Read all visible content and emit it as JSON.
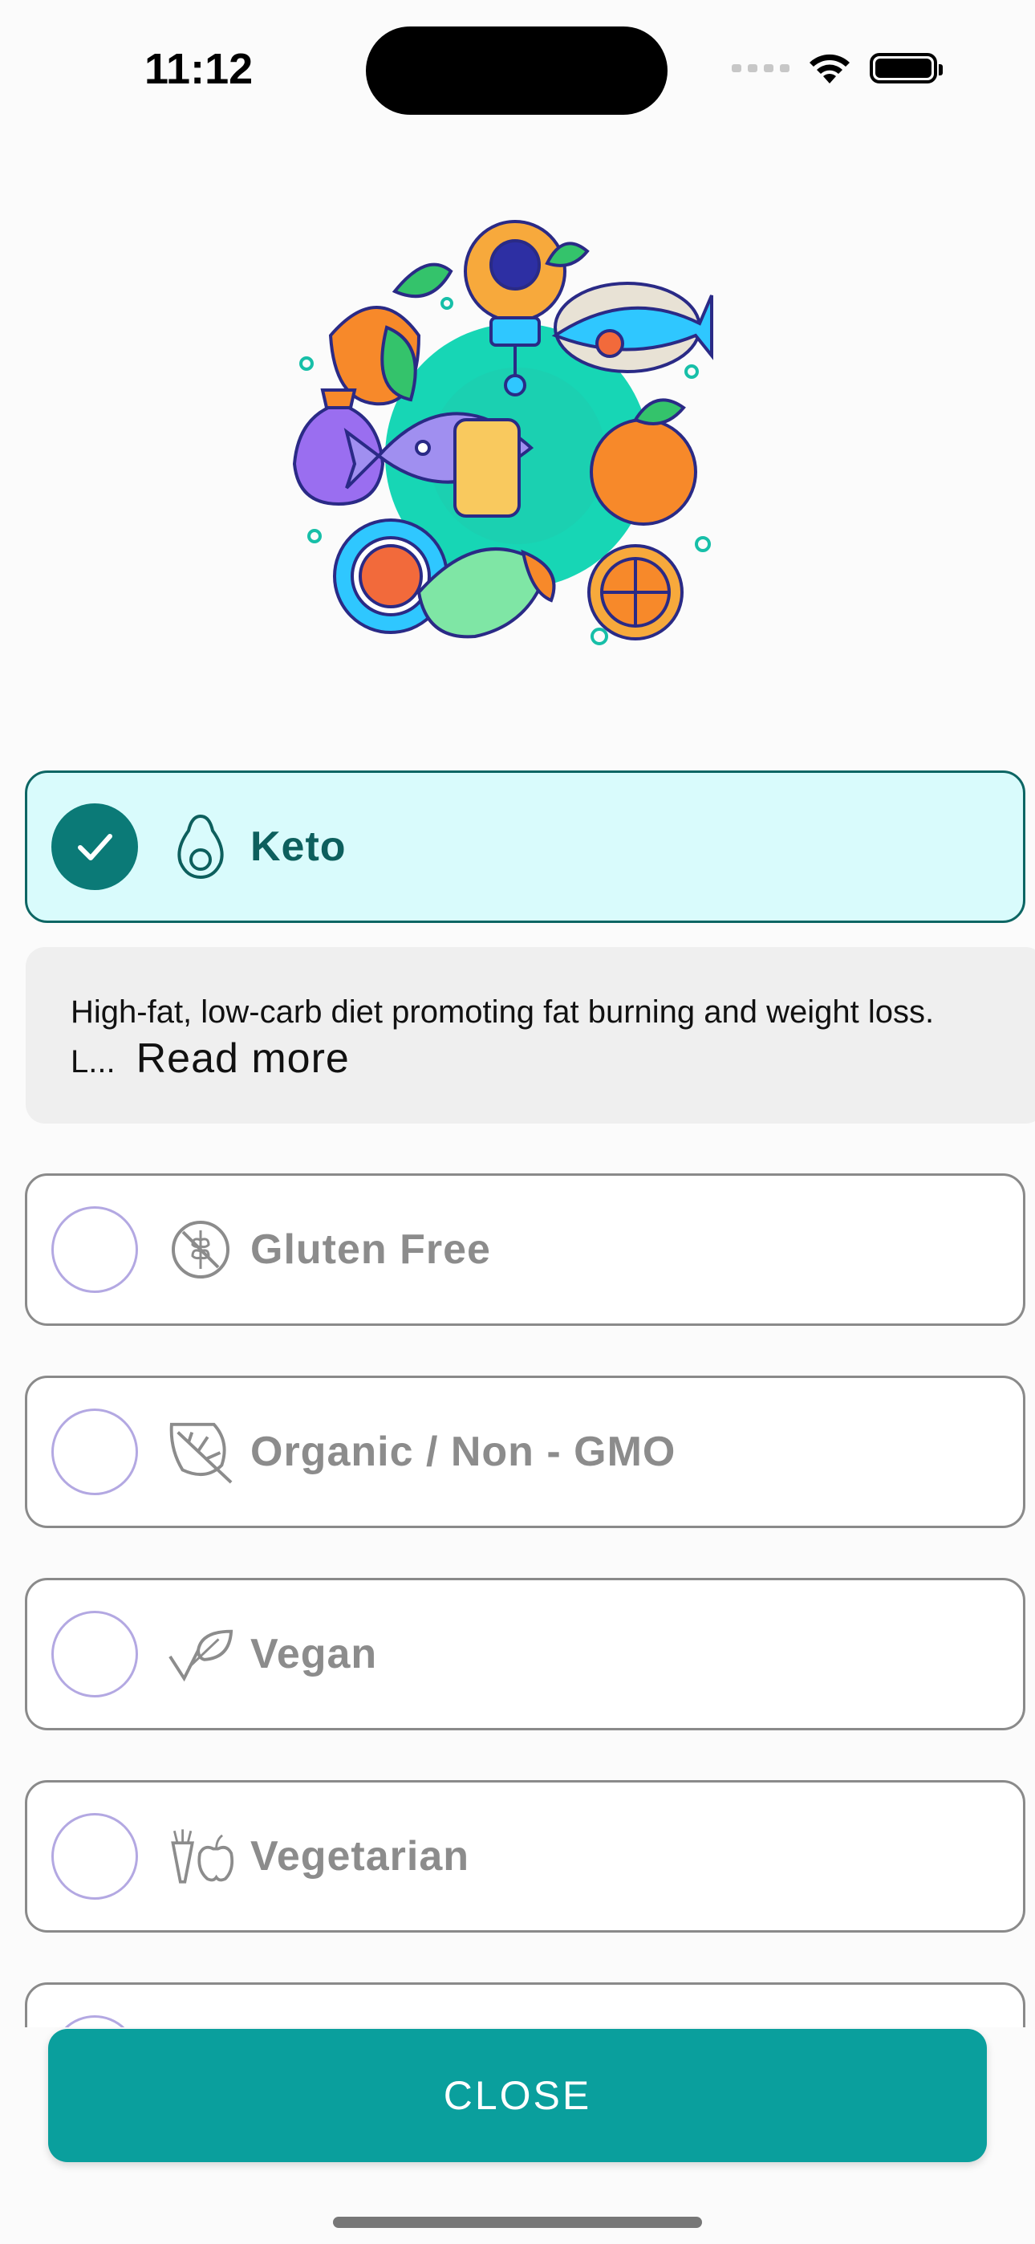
{
  "status": {
    "time": "11:12"
  },
  "options": [
    {
      "label": "Keto",
      "selected": true,
      "icon": "avocado-icon"
    },
    {
      "label": "Gluten Free",
      "selected": false,
      "icon": "wheat-crossed-icon"
    },
    {
      "label": "Organic / Non - GMO",
      "selected": false,
      "icon": "leaf-icon"
    },
    {
      "label": "Vegan",
      "selected": false,
      "icon": "sprout-icon"
    },
    {
      "label": "Vegetarian",
      "selected": false,
      "icon": "carrot-apple-icon"
    }
  ],
  "description": {
    "text": "High-fat, low-carb diet promoting fat burning and weight loss. L...",
    "read_more": "Read more"
  },
  "close_button": "CLOSE",
  "colors": {
    "accent": "#0a9f9d",
    "selected_bg": "#d9fbfc",
    "selected_check": "#0b7a77"
  }
}
